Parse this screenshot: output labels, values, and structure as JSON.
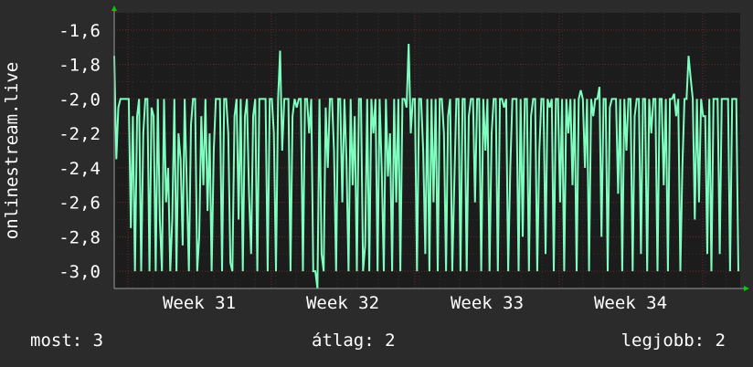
{
  "chart_data": {
    "type": "line",
    "title": "",
    "ylabel": "onlinestream.live",
    "xlabel": "",
    "ylim": [
      -3.1,
      -1.5
    ],
    "yticks": [
      "-1,6",
      "-1,8",
      "-2,0",
      "-2,2",
      "-2,4",
      "-2,6",
      "-2,8",
      "-3,0"
    ],
    "ytick_values": [
      -1.6,
      -1.8,
      -2.0,
      -2.2,
      -2.4,
      -2.6,
      -2.8,
      -3.0
    ],
    "xticks": [
      "Week 31",
      "Week 32",
      "Week 33",
      "Week 34"
    ],
    "grid": true,
    "series": [
      {
        "color": "#7fffbf",
        "values": [
          -1.75,
          -2.35,
          -2.05,
          -2.0,
          -2.0,
          -2.0,
          -2.0,
          -2.0,
          -2.75,
          -2.1,
          -3.0,
          -2.1,
          -2.0,
          -3.0,
          -2.2,
          -2.0,
          -2.0,
          -3.0,
          -2.05,
          -2.1,
          -3.0,
          -2.0,
          -2.7,
          -3.0,
          -2.0,
          -2.6,
          -2.4,
          -3.0,
          -2.7,
          -2.0,
          -3.0,
          -2.2,
          -2.35,
          -2.85,
          -2.0,
          -2.5,
          -3.0,
          -2.15,
          -2.0,
          -2.0,
          -3.0,
          -2.8,
          -2.1,
          -2.5,
          -2.0,
          -2.65,
          -2.2,
          -3.0,
          -2.3,
          -2.0,
          -2.0,
          -2.0,
          -3.0,
          -2.0,
          -2.0,
          -2.2,
          -2.95,
          -3.0,
          -2.1,
          -2.0,
          -2.7,
          -2.0,
          -3.0,
          -2.1,
          -2.0,
          -2.55,
          -2.9,
          -2.1,
          -2.0,
          -3.0,
          -2.0,
          -2.0,
          -2.0,
          -2.0,
          -3.0,
          -2.0,
          -2.0,
          -2.2,
          -3.0,
          -2.0,
          -1.72,
          -2.3,
          -2.0,
          -2.0,
          -2.0,
          -3.0,
          -2.1,
          -2.0,
          -2.05,
          -2.0,
          -2.0,
          -3.0,
          -2.0,
          -2.0,
          -2.2,
          -2.0,
          -3.0,
          -3.0,
          -3.1,
          -2.0,
          -2.9,
          -3.0,
          -2.05,
          -2.4,
          -2.0,
          -2.0,
          -2.3,
          -3.0,
          -2.0,
          -2.0,
          -2.6,
          -2.0,
          -2.35,
          -3.0,
          -2.0,
          -2.5,
          -2.1,
          -3.0,
          -2.0,
          -2.0,
          -3.0,
          -2.85,
          -2.0,
          -3.0,
          -2.0,
          -2.2,
          -2.0,
          -3.0,
          -2.0,
          -2.4,
          -3.0,
          -2.0,
          -2.45,
          -2.2,
          -3.0,
          -2.0,
          -2.6,
          -2.0,
          -3.0,
          -2.0,
          -2.0,
          -2.05,
          -1.68,
          -2.2,
          -2.0,
          -2.0,
          -3.0,
          -2.0,
          -2.0,
          -2.3,
          -2.9,
          -2.0,
          -3.0,
          -2.0,
          -2.6,
          -2.0,
          -3.0,
          -2.0,
          -2.0,
          -2.2,
          -3.0,
          -2.1,
          -2.0,
          -3.0,
          -2.5,
          -2.0,
          -2.0,
          -3.0,
          -2.0,
          -2.0,
          -3.0,
          -2.1,
          -2.0,
          -2.0,
          -2.6,
          -2.0,
          -2.0,
          -3.0,
          -2.0,
          -2.3,
          -2.0,
          -3.0,
          -2.2,
          -2.0,
          -2.0,
          -3.0,
          -2.0,
          -2.0,
          -2.05,
          -2.0,
          -3.0,
          -2.4,
          -2.0,
          -2.0,
          -2.0,
          -3.0,
          -2.0,
          -2.8,
          -2.0,
          -2.0,
          -3.0,
          -2.1,
          -2.0,
          -2.0,
          -3.0,
          -2.3,
          -2.0,
          -2.0,
          -2.9,
          -2.0,
          -2.05,
          -2.0,
          -3.0,
          -2.0,
          -2.0,
          -2.6,
          -2.0,
          -3.0,
          -2.0,
          -2.2,
          -2.0,
          -2.5,
          -2.0,
          -3.0,
          -2.0,
          -1.95,
          -2.0,
          -2.4,
          -2.0,
          -3.0,
          -2.0,
          -2.1,
          -2.0,
          -2.0,
          -1.93,
          -2.8,
          -2.0,
          -2.0,
          -3.0,
          -2.05,
          -2.0,
          -2.0,
          -2.0,
          -2.55,
          -2.0,
          -3.0,
          -2.0,
          -2.3,
          -2.0,
          -2.0,
          -3.0,
          -2.1,
          -2.0,
          -2.0,
          -2.9,
          -2.0,
          -2.0,
          -3.0,
          -2.0,
          -2.2,
          -2.0,
          -2.0,
          -3.0,
          -2.0,
          -2.0,
          -2.5,
          -2.0,
          -3.0,
          -2.0,
          -2.0,
          -1.97,
          -2.1,
          -2.0,
          -3.0,
          -2.4,
          -2.0,
          -2.0,
          -1.75,
          -1.88,
          -2.0,
          -2.7,
          -2.0,
          -2.6,
          -2.0,
          -2.1,
          -2.1,
          -2.9,
          -2.0,
          -3.0,
          -2.0,
          -2.0,
          -2.0,
          -2.9,
          -2.0,
          -2.0,
          -2.0,
          -2.0,
          -3.0,
          -2.0,
          -2.0,
          -2.0,
          -3.0
        ]
      }
    ]
  },
  "footer": {
    "current": "most: 3",
    "average": "átlag: 2",
    "best": "legjobb: 2"
  },
  "colors": {
    "background": "#2b2b2b",
    "plot_background": "#1c1c1c",
    "grid": "#6a2a2a",
    "line": "#7fffbf",
    "axis_arrow": "#00cc00",
    "text": "#ffffff"
  }
}
